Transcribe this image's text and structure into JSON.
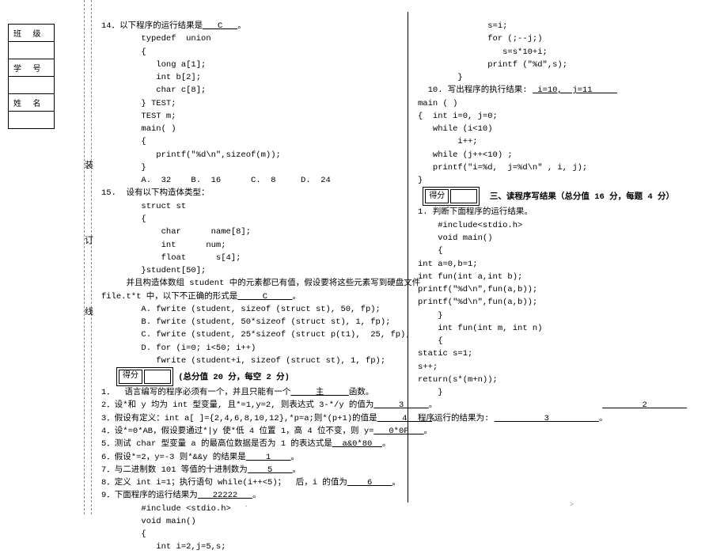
{
  "info_labels": {
    "class": "班 级",
    "id": "学 号",
    "name": "姓 名"
  },
  "margin_chars": {
    "c1": "装",
    "c2": "订",
    "c3": "线"
  },
  "score_label": "得分",
  "col1": {
    "q14_head": "14．以下程序的运行结果是",
    "q14_ans": "   C   ",
    "q14_tail": "。",
    "q14_code": [
      "        typedef  union",
      "        {",
      "           long a[1];",
      "           int b[2];",
      "           char c[8];",
      "        } TEST;",
      "        TEST m;",
      "        main( )",
      "        {",
      "           printf(\"%d\\n\",sizeof(m));",
      "        }",
      "        A.  32    B.  16      C.  8     D.  24"
    ],
    "q15_head": "15.  设有以下构造体类型：",
    "q15_code": [
      "        struct st",
      "        {",
      "            char      name[8];",
      "            int      num;",
      "            float      s[4];",
      "        }student[50];"
    ],
    "q15_desc1": "     并且构造体数组 student 中的元素都已有值，假设要将这些元素写到硬盘文件",
    "q15_desc2_a": "file.t*t 中，以下不正确的形式是",
    "q15_desc2_u": "     C     ",
    "q15_desc2_b": "。",
    "q15_opts": [
      "        A. fwrite (student, sizeof (struct st), 50, fp);",
      "        B. fwrite (student, 50*sizeof (struct st), 1, fp);",
      "        C. fwrite (student, 25*sizeof (struct p(t1),  25, fp);",
      "        D. for (i=0; i<50; i++)",
      "           fwrite (student+i, sizeof (struct st), 1, fp);"
    ],
    "sec2_title": "(总分值 20 分，每空 2 分)",
    "fb1_a": "1．  语言编写的程序必须有一个，并且只能有一个",
    "fb1_u": "     主     ",
    "fb1_b": "函数。",
    "fb2_a": "2．设*和 y 均为 int 型变量, 且*=1,y=2, 则表达式 3-*/y 的值为",
    "fb2_u": "     3     ",
    "fb2_b": "。",
    "fb3_a": "3．假设有定义：int a[ ]={2,4,6,8,10,12},*p=a;则*(p+1)的值是",
    "fb3_u": "     4     ",
    "fb3_b": "。",
    "fb4_a": "4．设*=0*AB，假设要通过*|y 使*低 4 位置 1，高 4 位不变，则 y=",
    "fb4_u": "   0*0F   ",
    "fb4_b": "。",
    "fb5_a": "5．测试 char 型变量 a 的最高位数据是否为 1 的表达式是",
    "fb5_u": "  a&0*80  ",
    "fb5_b": "。",
    "fb6_a": "6．假设*=2，y=-3 则*&&y 的结果是",
    "fb6_u": "    1    ",
    "fb6_b": "。",
    "fb7_a": "7．与二进制数 101 等值的十进制数为",
    "fb7_u": "    5    ",
    "fb7_b": "。",
    "fb8_a": "8．定义 int i=1；执行语句 while(i++<5)；  后，i 的值为",
    "fb8_u": "    6    ",
    "fb8_b": "。",
    "fb9_a": "9．下面程序的运行结果为",
    "fb9_u": "   22222   ",
    "fb9_b": "。",
    "q9_code": [
      "        #include <stdio.h>",
      "        void main()",
      "        {",
      "           int i=2,j=5,s;"
    ]
  },
  "col2": {
    "top_code": [
      "              s=i;",
      "              for (;--j;)",
      "                 s=s*10+i;",
      "              printf (\"%d\",s);",
      "        }"
    ],
    "q10_a": "  10. 写出程序的执行结果: ",
    "q10_u": " i=10,  j=11     ",
    "q10_code": [
      "main ( )",
      "{  int i=0, j=0;",
      "   while (i<10)",
      "        i++;",
      "   while (j++<10) ;",
      "   printf(\"i=%d,  j=%d\\n\" , i, j);",
      "}"
    ],
    "sec3_title": "三、读程序写结果（总分值 16 分，每题 4 分）",
    "p1_head": "1. 判断下面程序的运行结果。",
    "p1_code": [
      "    #include<stdio.h>",
      "    void main()",
      "    {",
      "int a=0,b=1;",
      "int fun(int a,int b);",
      "printf(\"%d\\n\",fun(a,b));",
      "printf(\"%d\\n\",fun(a,b));",
      "    }",
      "    int fun(int m, int n)",
      "    {",
      "static s=1;",
      "s++;",
      "return(s*(m+n));",
      "    }"
    ],
    "res_a": "                                     ",
    "res_u1": "        2        ",
    "res2_a": "程序运行的结果为: ",
    "res2_u": "          3          ",
    "res2_b": "。",
    "foot_right": ">"
  },
  "footnote_left": "."
}
